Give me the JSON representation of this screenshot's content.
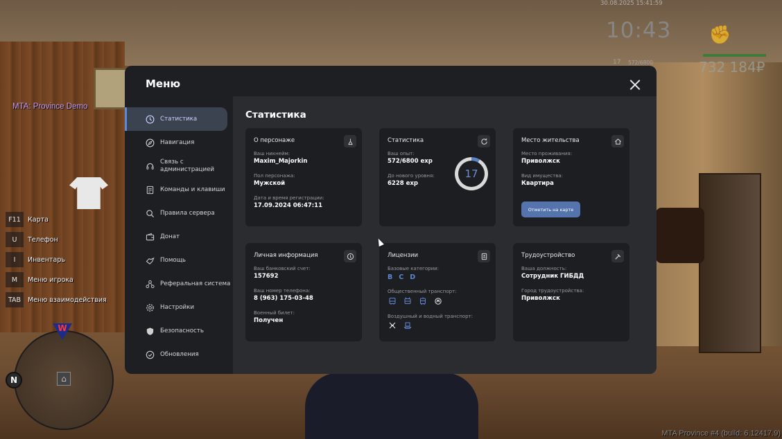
{
  "hud": {
    "server_title": "MTA: Province Demo",
    "datetime": "30.08.2025 15:41:59",
    "clock": "10:43",
    "level": "17",
    "exp": "572/6800",
    "money": "732 184₽",
    "build": "MTA Province #4 (build: 6.12417.9)",
    "minimap_north": "N",
    "minimap_marker": "W",
    "hotkeys": [
      {
        "key": "F11",
        "label": "Карта"
      },
      {
        "key": "U",
        "label": "Телефон"
      },
      {
        "key": "I",
        "label": "Инвентарь"
      },
      {
        "key": "M",
        "label": "Меню игрока"
      },
      {
        "key": "TAB",
        "label": "Меню взаимодействия"
      }
    ]
  },
  "menu": {
    "title": "Меню",
    "sidebar": [
      {
        "label": "Статистика",
        "icon": "clock-icon"
      },
      {
        "label": "Навигация",
        "icon": "compass-icon"
      },
      {
        "label": "Связь с администрацией",
        "icon": "headset-icon"
      },
      {
        "label": "Команды и клавиши",
        "icon": "list-icon"
      },
      {
        "label": "Правила сервера",
        "icon": "rules-icon"
      },
      {
        "label": "Донат",
        "icon": "wallet-icon"
      },
      {
        "label": "Помощь",
        "icon": "help-icon"
      },
      {
        "label": "Реферальная система",
        "icon": "referral-icon"
      },
      {
        "label": "Настройки",
        "icon": "gear-icon"
      },
      {
        "label": "Безопасность",
        "icon": "shield-icon"
      },
      {
        "label": "Обновления",
        "icon": "update-icon"
      }
    ],
    "active_index": 0,
    "content_title": "Статистика",
    "cards": {
      "character": {
        "title": "О персонаже",
        "nickname_label": "Ваш никнейм:",
        "nickname": "Maxim_Majorkin",
        "gender_label": "Пол персонажа:",
        "gender": "Мужской",
        "reg_label": "Дата и время регистрации:",
        "reg": "17.09.2024 06:47:11"
      },
      "stats": {
        "title": "Статистика",
        "exp_label": "Ваш опыт:",
        "exp": "572/6800 exp",
        "next_label": "До нового уровня:",
        "next": "6228 exp",
        "level": "17",
        "progress": 0.084
      },
      "residence": {
        "title": "Место жительства",
        "place_label": "Место проживания:",
        "place": "Приволжск",
        "property_label": "Вид имущества:",
        "property": "Квартира",
        "map_button": "Отметить на карте"
      },
      "personal": {
        "title": "Личная информация",
        "bank_label": "Ваш банковский счет:",
        "bank": "157692",
        "phone_label": "Ваш номер телефона:",
        "phone": "8 (963) 175-03-48",
        "military_label": "Военный билет:",
        "military": "Получен"
      },
      "licenses": {
        "title": "Лицензии",
        "basic_label": "Базовые категории:",
        "categories": [
          "B",
          "C",
          "D"
        ],
        "public_label": "Общественный транспорт:",
        "air_label": "Воздушный и водный транспорт:"
      },
      "employment": {
        "title": "Трудоустройство",
        "position_label": "Ваша должность:",
        "position": "Сотрудник ГИБДД",
        "city_label": "Город трудоустройства:",
        "city": "Приволжск"
      }
    }
  }
}
